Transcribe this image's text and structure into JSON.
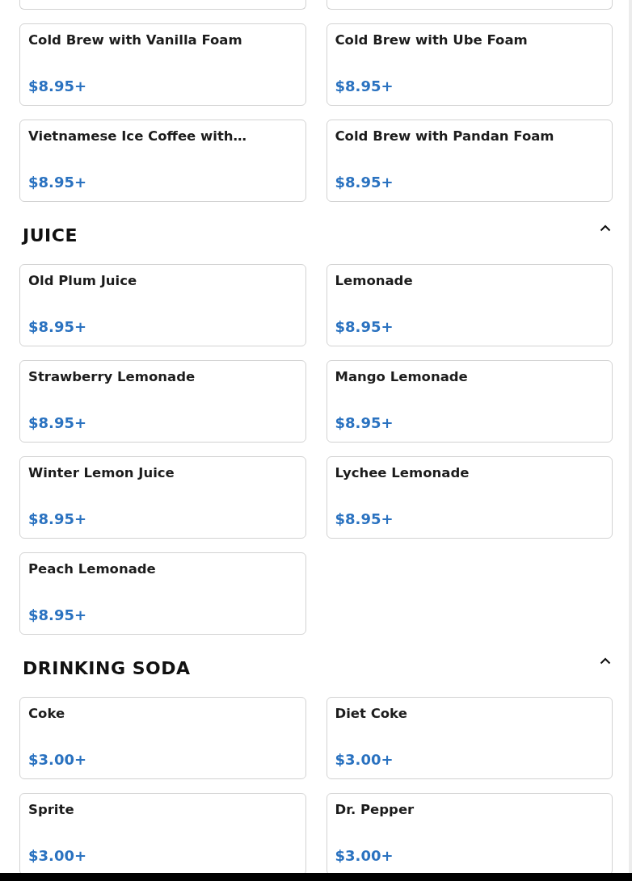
{
  "sections": [
    {
      "items": [
        {
          "name": "Cold Brew with Vanilla Foam",
          "price": "$8.95+"
        },
        {
          "name": "Cold Brew with Ube Foam",
          "price": "$8.95+"
        },
        {
          "name": "Vietnamese Ice Coffee with…",
          "price": "$8.95+"
        },
        {
          "name": "Cold Brew with Pandan Foam",
          "price": "$8.95+"
        }
      ]
    },
    {
      "title": "JUICE",
      "expanded": true,
      "items": [
        {
          "name": "Old Plum Juice",
          "price": "$8.95+"
        },
        {
          "name": "Lemonade",
          "price": "$8.95+"
        },
        {
          "name": "Strawberry Lemonade",
          "price": "$8.95+"
        },
        {
          "name": "Mango Lemonade",
          "price": "$8.95+"
        },
        {
          "name": "Winter Lemon Juice",
          "price": "$8.95+"
        },
        {
          "name": "Lychee Lemonade",
          "price": "$8.95+"
        },
        {
          "name": "Peach Lemonade",
          "price": "$8.95+"
        }
      ]
    },
    {
      "title": "DRINKING SODA",
      "expanded": true,
      "items": [
        {
          "name": "Coke",
          "price": "$3.00+"
        },
        {
          "name": "Diet Coke",
          "price": "$3.00+"
        },
        {
          "name": "Sprite",
          "price": "$3.00+"
        },
        {
          "name": "Dr. Pepper",
          "price": "$3.00+"
        }
      ]
    }
  ]
}
